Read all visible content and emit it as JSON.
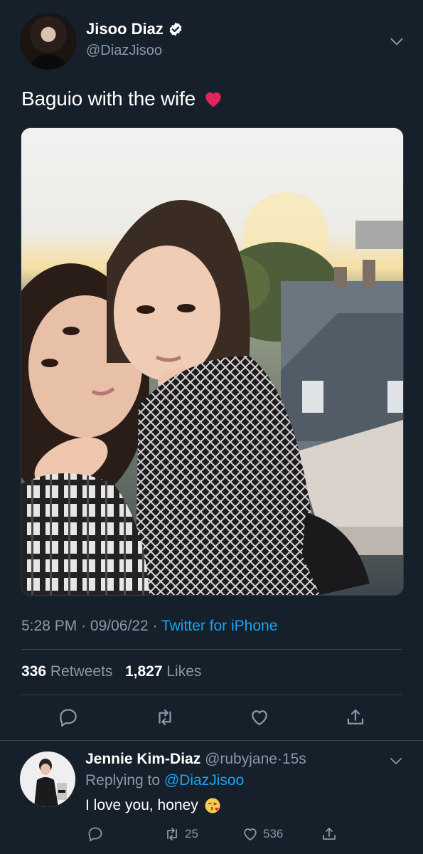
{
  "tweet": {
    "author": {
      "display_name": "Jisoo Diaz",
      "handle": "@DiazJisoo",
      "verified": true
    },
    "text": "Baguio with the wife",
    "emoji": "heart",
    "photo_description_icon": "photo-image",
    "meta": {
      "time": "5:28 PM",
      "date": "09/06/22",
      "sep": "·",
      "source": "Twitter for iPhone"
    },
    "stats": {
      "retweets_count": "336",
      "retweets_label": "Retweets",
      "likes_count": "1,827",
      "likes_label": "Likes"
    },
    "actions": [
      "reply-icon",
      "retweet-icon",
      "like-icon",
      "share-icon"
    ]
  },
  "reply": {
    "display_name": "Jennie Kim-Diaz",
    "handle": "@rubyjane",
    "sep": "·",
    "time": "15s",
    "replying_prefix": "Replying to",
    "replying_to": "@DiazJisoo",
    "text": "I love you, honey",
    "emoji": "kissing-face",
    "retweets": "25",
    "likes": "536"
  },
  "colors": {
    "background": "#15202b",
    "secondary_text": "#8899a6",
    "accent": "#1da1f2",
    "divider": "#38444d",
    "heart": "#e0245e"
  }
}
